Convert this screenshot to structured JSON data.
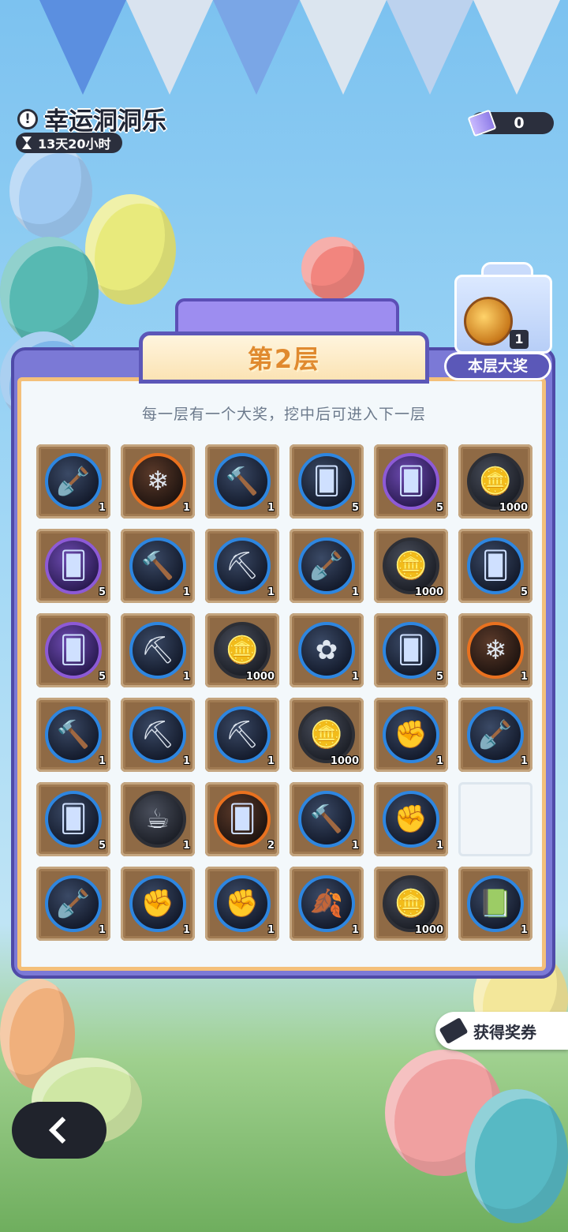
{
  "header": {
    "title": "幸运洞洞乐",
    "timer": "13天20小时",
    "ticket_count": "0"
  },
  "board": {
    "floor_label": "第2层",
    "subtitle": "每一层有一个大奖，挖中后可进入下一层"
  },
  "grand_prize": {
    "label": "本层大奖",
    "count": "1"
  },
  "grid": [
    [
      {
        "item": "shovel",
        "qty": "1"
      },
      {
        "item": "crystal",
        "qty": "1"
      },
      {
        "item": "hammer",
        "qty": "1"
      },
      {
        "item": "card-blue",
        "qty": "5"
      },
      {
        "item": "card-purple",
        "qty": "5"
      },
      {
        "item": "coin",
        "qty": "1000"
      }
    ],
    [
      {
        "item": "card-purple",
        "qty": "5"
      },
      {
        "item": "hammer",
        "qty": "1"
      },
      {
        "item": "pickaxe",
        "qty": "1"
      },
      {
        "item": "shovel",
        "qty": "1"
      },
      {
        "item": "coin",
        "qty": "1000"
      },
      {
        "item": "card-blue",
        "qty": "5"
      }
    ],
    [
      {
        "item": "card-purple",
        "qty": "5"
      },
      {
        "item": "pickaxe",
        "qty": "1"
      },
      {
        "item": "coin",
        "qty": "1000"
      },
      {
        "item": "flower",
        "qty": "1"
      },
      {
        "item": "card-blue",
        "qty": "5"
      },
      {
        "item": "crystal",
        "qty": "1"
      }
    ],
    [
      {
        "item": "hammer",
        "qty": "1"
      },
      {
        "item": "pickaxe",
        "qty": "1"
      },
      {
        "item": "pickaxe",
        "qty": "1"
      },
      {
        "item": "coin",
        "qty": "1000"
      },
      {
        "item": "glove",
        "qty": "1"
      },
      {
        "item": "shovel",
        "qty": "1"
      }
    ],
    [
      {
        "item": "card-blue",
        "qty": "5"
      },
      {
        "item": "cup",
        "qty": "1"
      },
      {
        "item": "card-orange",
        "qty": "2"
      },
      {
        "item": "hammer",
        "qty": "1"
      },
      {
        "item": "glove",
        "qty": "1"
      },
      {
        "item": "empty",
        "qty": ""
      }
    ],
    [
      {
        "item": "shovel",
        "qty": "1"
      },
      {
        "item": "glove",
        "qty": "1"
      },
      {
        "item": "glove",
        "qty": "1"
      },
      {
        "item": "leaf",
        "qty": "1"
      },
      {
        "item": "coin",
        "qty": "1000"
      },
      {
        "item": "book",
        "qty": "1"
      }
    ]
  ],
  "actions": {
    "voucher_label": "获得奖券"
  },
  "colors": {
    "accent": "#e08a2f",
    "panel": "#7b79d6",
    "dark": "#2b2f3d"
  }
}
